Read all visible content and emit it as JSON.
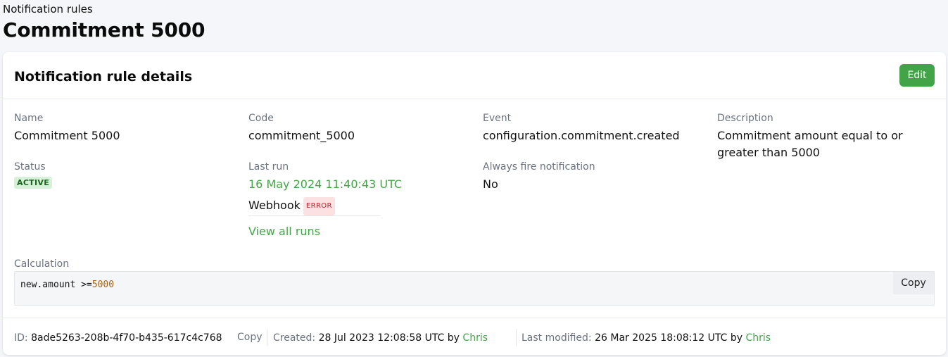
{
  "breadcrumb": "Notification rules",
  "page_title": "Commitment 5000",
  "card": {
    "title": "Notification rule details",
    "edit_label": "Edit"
  },
  "fields": {
    "name": {
      "label": "Name",
      "value": "Commitment 5000"
    },
    "code": {
      "label": "Code",
      "value": "commitment_5000"
    },
    "event": {
      "label": "Event",
      "value": "configuration.commitment.created"
    },
    "description": {
      "label": "Description",
      "value": "Commitment amount equal to or greater than 5000"
    },
    "status": {
      "label": "Status",
      "value": "ACTIVE"
    },
    "last_run": {
      "label": "Last run",
      "value": "16 May 2024 11:40:43 UTC",
      "channel": "Webhook",
      "channel_status": "ERROR",
      "view_all": "View all runs"
    },
    "always_fire": {
      "label": "Always fire notification",
      "value": "No"
    }
  },
  "calculation": {
    "label": "Calculation",
    "code_prefix": "new.amount >=",
    "code_number": "5000",
    "copy_label": "Copy"
  },
  "footer": {
    "id_label": "ID:",
    "id_value": "8ade5263-208b-4f70-b435-617c4c768",
    "copy_label": "Copy",
    "created_label": "Created:",
    "created_value": "28 Jul 2023 12:08:58 UTC by",
    "created_by": "Chris",
    "modified_label": "Last modified:",
    "modified_value": "26 Mar 2025 18:08:12 UTC by",
    "modified_by": "Chris"
  },
  "colors": {
    "accent": "#43a447",
    "error": "#b3262d"
  }
}
